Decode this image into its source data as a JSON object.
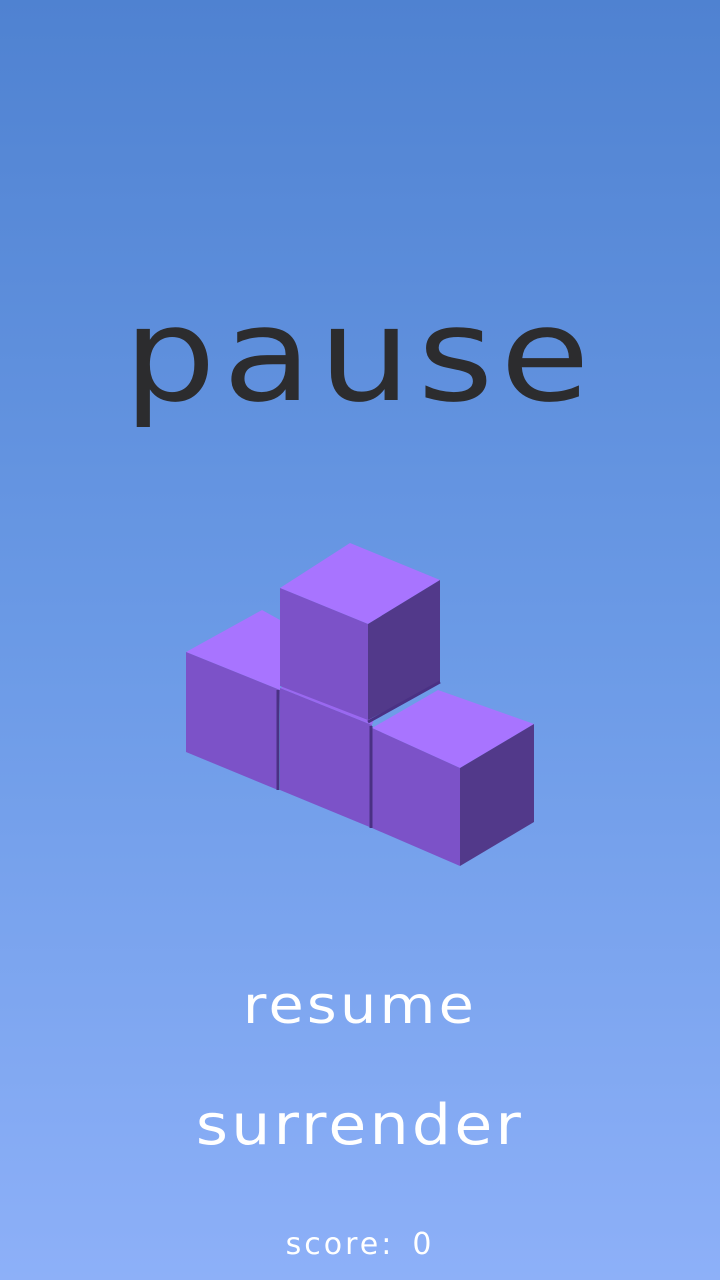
{
  "screen": {
    "title": "pause",
    "background_top": "#4f82d1",
    "background_bottom": "#8db0f8"
  },
  "illustration": {
    "icon": "tetromino-t-block-icon",
    "color": "#7b52c8"
  },
  "menu": {
    "resume_label": "resume",
    "surrender_label": "surrender"
  },
  "score": {
    "label": "score:",
    "value": "0"
  }
}
